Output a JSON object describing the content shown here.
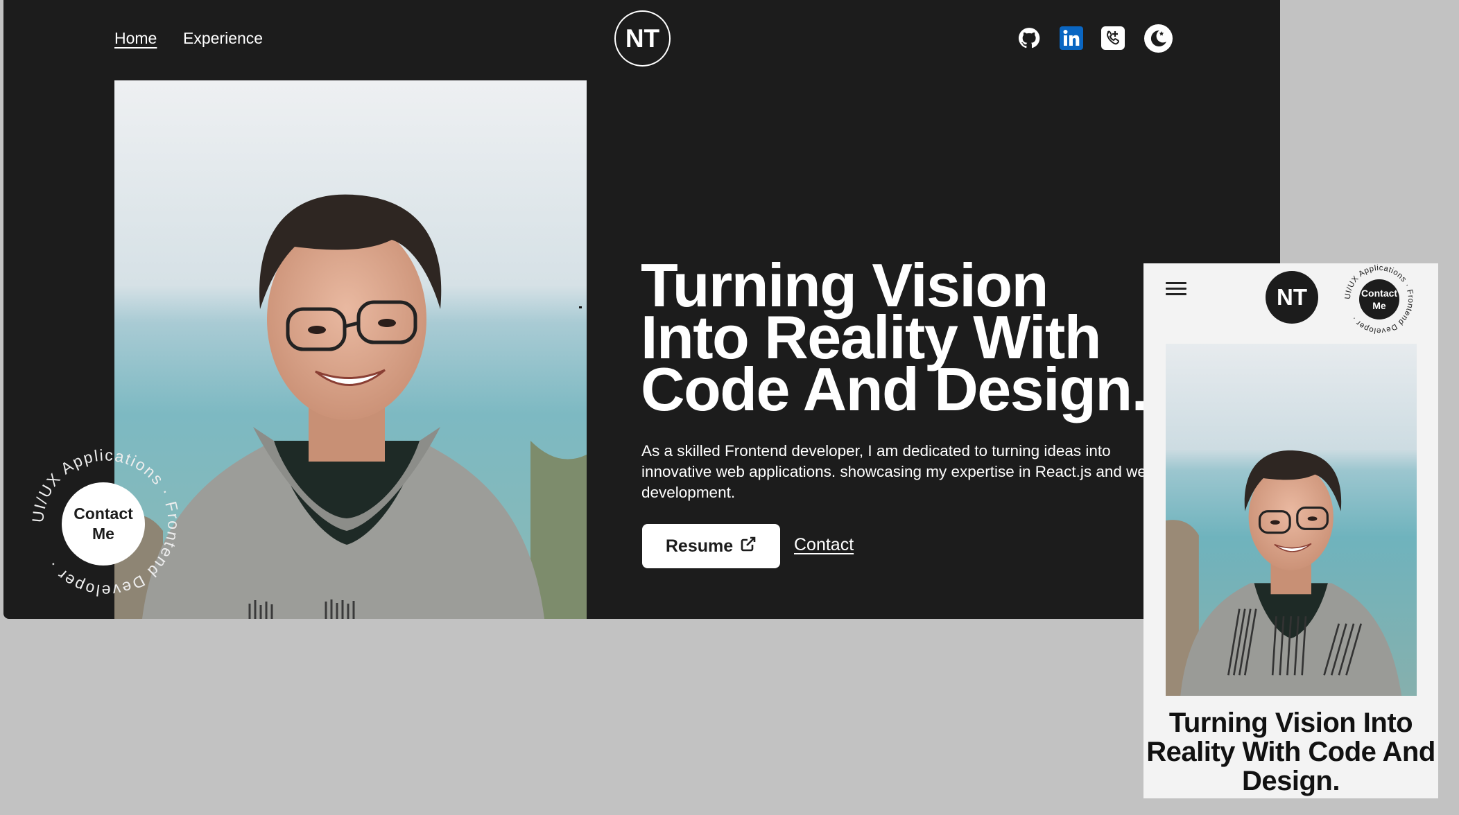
{
  "desktop": {
    "nav": {
      "home_label": "Home",
      "experience_label": "Experience"
    },
    "logo_text": "NT",
    "social_icons": [
      "github-icon",
      "linkedin-icon",
      "phone-icon",
      "theme-toggle-icon"
    ],
    "hero": {
      "title": "Turning Vision Into Reality With Code And Design.",
      "description": "As a skilled Frontend developer, I am dedicated to turning ideas into innovative web applications. showcasing my expertise in React.js and web development.",
      "resume_label": "Resume",
      "contact_label": "Contact"
    },
    "badge": {
      "ring_text": "UI/UX Applications · Frontend Developer ·",
      "center_line1": "Contact",
      "center_line2": "Me"
    }
  },
  "mobile": {
    "logo_text": "NT",
    "badge": {
      "ring_text": "UI/UX Applications · Frontend Developer ·",
      "center_line1": "Contact",
      "center_line2": "Me"
    },
    "hero_title": "Turning Vision Into Reality With Code And Design."
  },
  "colors": {
    "desktop_bg": "#1c1c1c",
    "page_bg": "#c2c2c2",
    "mobile_bg": "#f3f3f3",
    "linkedin_blue": "#0a66c2"
  }
}
